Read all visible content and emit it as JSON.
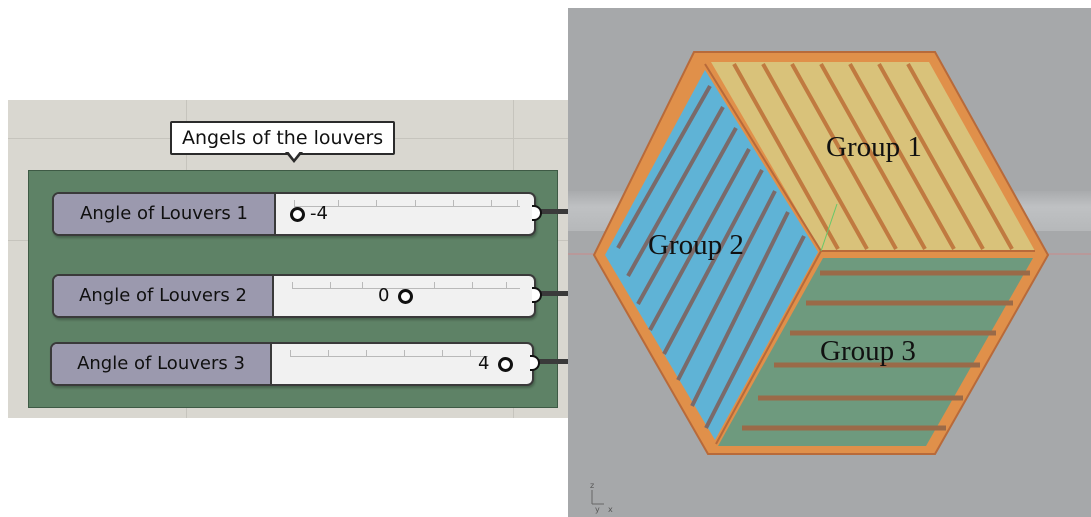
{
  "grasshopper": {
    "group_label": "Angels of the louvers",
    "sliders": [
      {
        "name": "Angle of Louvers 1",
        "value": "-4",
        "position_fraction": 0.0
      },
      {
        "name": "Angle of Louvers 2",
        "value": "0",
        "position_fraction": 0.5
      },
      {
        "name": "Angle of Louvers 3",
        "value": "4",
        "position_fraction": 1.0
      }
    ],
    "colors": {
      "group_fill": "#5e8266",
      "slider_name_fill": "#9b99ae",
      "canvas": "#d9d7d0"
    }
  },
  "viewport": {
    "group_labels": [
      "Group 1",
      "Group 2",
      "Group 3"
    ],
    "axis": {
      "z": "z",
      "y": "y",
      "x": "x"
    },
    "colors": {
      "top_face": "#d9c27a",
      "left_face": "#5fb3d6",
      "right_face": "#6e9a7e",
      "frame": "#e0904a",
      "louver": "#9a6a48",
      "background": "#a6a8aa"
    }
  }
}
